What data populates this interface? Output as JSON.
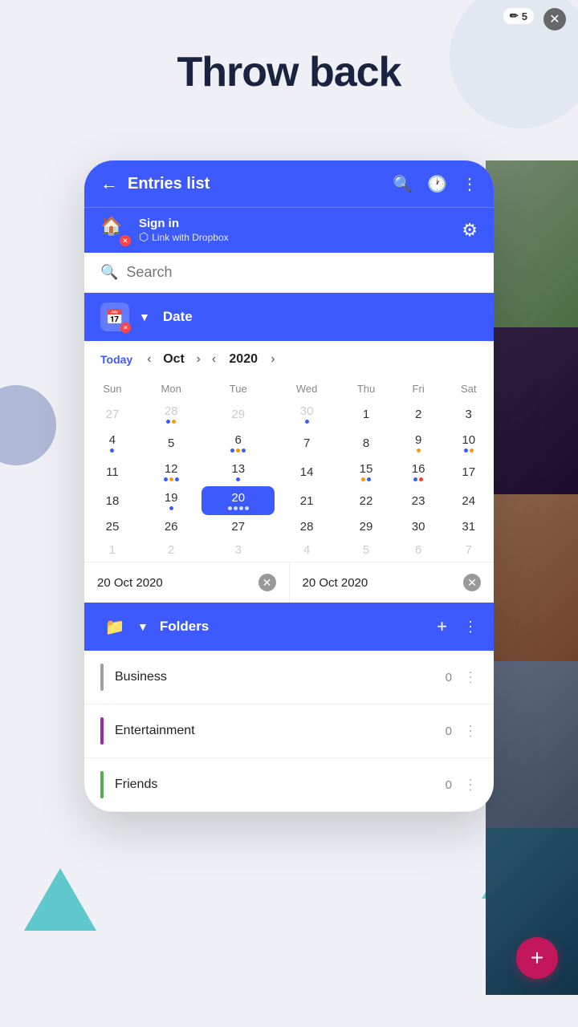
{
  "page": {
    "title": "Throw back"
  },
  "header": {
    "back_label": "←",
    "title": "Entries list",
    "search_icon": "🔍",
    "history_icon": "🕐",
    "more_icon": "⋮"
  },
  "signin_bar": {
    "home_icon": "🏠",
    "sign_in_text": "Sign in",
    "dropbox_text": "Link with Dropbox",
    "gear_icon": "⚙"
  },
  "search": {
    "placeholder": "Search"
  },
  "date_section": {
    "icon": "📅",
    "title": "Date",
    "chevron": "▼"
  },
  "calendar": {
    "today_label": "Today",
    "month": "Oct",
    "year": "2020",
    "weekdays": [
      "Sun",
      "Mon",
      "Tue",
      "Wed",
      "Thu",
      "Fri",
      "Sat"
    ],
    "weeks": [
      [
        {
          "day": "27",
          "other": true,
          "dots": []
        },
        {
          "day": "28",
          "other": true,
          "dots": [
            "blue",
            "orange"
          ]
        },
        {
          "day": "29",
          "other": true,
          "dots": []
        },
        {
          "day": "30",
          "other": true,
          "dots": [
            "blue"
          ]
        },
        {
          "day": "1",
          "dots": []
        },
        {
          "day": "2",
          "dots": []
        },
        {
          "day": "3",
          "dots": []
        }
      ],
      [
        {
          "day": "4",
          "dots": [
            "blue"
          ]
        },
        {
          "day": "5",
          "dots": []
        },
        {
          "day": "6",
          "dots": [
            "blue",
            "orange",
            "blue"
          ]
        },
        {
          "day": "7",
          "dots": []
        },
        {
          "day": "8",
          "dots": []
        },
        {
          "day": "9",
          "dots": [
            "orange"
          ]
        },
        {
          "day": "10",
          "dots": [
            "blue",
            "orange"
          ]
        }
      ],
      [
        {
          "day": "11",
          "dots": []
        },
        {
          "day": "12",
          "dots": [
            "blue",
            "orange",
            "blue"
          ]
        },
        {
          "day": "13",
          "dots": [
            "blue"
          ]
        },
        {
          "day": "14",
          "dots": []
        },
        {
          "day": "15",
          "dots": [
            "orange",
            "blue"
          ]
        },
        {
          "day": "16",
          "dots": [
            "blue",
            "red"
          ]
        },
        {
          "day": "17",
          "dots": []
        }
      ],
      [
        {
          "day": "18",
          "dots": []
        },
        {
          "day": "19",
          "dots": [
            "blue"
          ]
        },
        {
          "day": "20",
          "selected": true,
          "dots": [
            "blue",
            "orange",
            "orange",
            "blue"
          ]
        },
        {
          "day": "21",
          "dots": []
        },
        {
          "day": "22",
          "dots": []
        },
        {
          "day": "23",
          "dots": []
        },
        {
          "day": "24",
          "dots": []
        }
      ],
      [
        {
          "day": "25",
          "dots": []
        },
        {
          "day": "26",
          "dots": []
        },
        {
          "day": "27",
          "dots": []
        },
        {
          "day": "28",
          "dots": []
        },
        {
          "day": "29",
          "dots": []
        },
        {
          "day": "30",
          "dots": []
        },
        {
          "day": "31",
          "dots": []
        }
      ],
      [
        {
          "day": "1",
          "other": true,
          "dots": []
        },
        {
          "day": "2",
          "other": true,
          "dots": []
        },
        {
          "day": "3",
          "other": true,
          "dots": []
        },
        {
          "day": "4",
          "other": true,
          "dots": []
        },
        {
          "day": "5",
          "other": true,
          "dots": []
        },
        {
          "day": "6",
          "other": true,
          "dots": []
        },
        {
          "day": "7",
          "other": true,
          "dots": []
        }
      ]
    ]
  },
  "date_range": {
    "start": "20 Oct 2020",
    "end": "20 Oct 2020"
  },
  "folders_section": {
    "icon": "📁",
    "chevron": "▼",
    "title": "Folders",
    "add_icon": "+",
    "more_icon": "⋮"
  },
  "folders": [
    {
      "name": "Business",
      "count": "0",
      "color": "#9e9e9e"
    },
    {
      "name": "Entertainment",
      "count": "0",
      "color": "#9c27b0"
    },
    {
      "name": "Friends",
      "count": "0",
      "color": "#4caf50"
    }
  ],
  "photo_counter": "✏ 5",
  "fab_icon": "+"
}
